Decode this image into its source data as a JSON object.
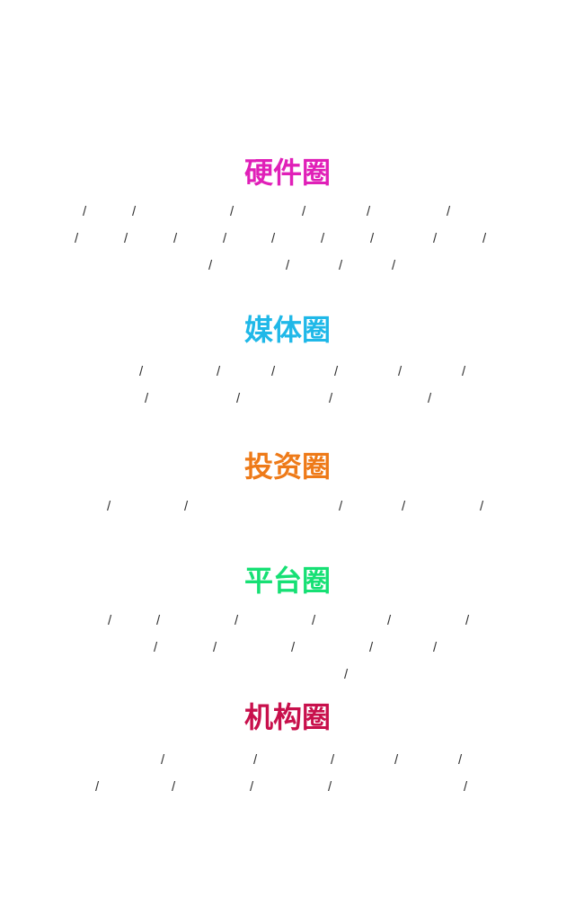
{
  "separator": "/",
  "sections": [
    {
      "title": "硬件圈",
      "color": "#e020b8",
      "rows": [
        {
          "count": 6
        },
        {
          "count": 9
        },
        {
          "count": 4
        }
      ]
    },
    {
      "title": "媒体圈",
      "color": "#1fb8e8",
      "rows": [
        {
          "count": 6
        },
        {
          "count": 4
        }
      ]
    },
    {
      "title": "投资圈",
      "color": "#ee7a18",
      "rows": [
        {
          "count": 5
        }
      ]
    },
    {
      "title": "平台圈",
      "color": "#16e074",
      "rows": [
        {
          "count": 6
        },
        {
          "count": 5
        },
        {
          "count": 1
        }
      ]
    },
    {
      "title": "机构圈",
      "color": "#c8104c",
      "rows": [
        {
          "count": 5
        },
        {
          "count": 5
        }
      ]
    }
  ]
}
